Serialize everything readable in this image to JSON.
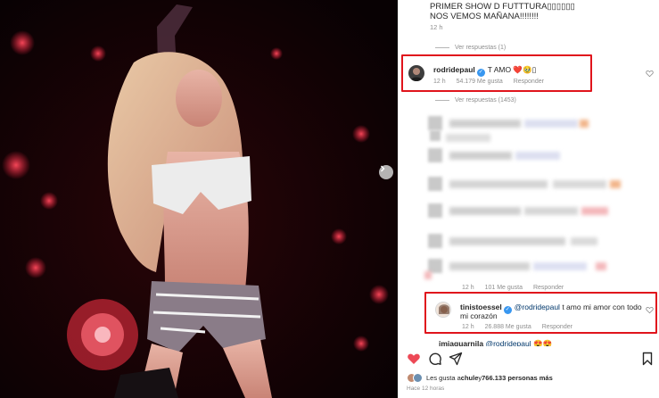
{
  "caption": {
    "lines": [
      "PRIMER SHOW D FUTTTURA▯▯▯▯▯▯",
      "NOS VEMOS MAÑANA!!!!!!!!"
    ],
    "time": "12 h"
  },
  "view_replies_1": "Ver respuestas (1)",
  "comment_rodri": {
    "username": "rodridepaul",
    "text": "T AMO ❤️🥹▯",
    "time": "12 h",
    "likes": "54.179 Me gusta",
    "reply": "Responder"
  },
  "view_replies_1453": "Ver respuestas (1453)",
  "comment_partial": {
    "time": "12 h",
    "likes": "101 Me gusta",
    "reply": "Responder"
  },
  "comment_tini": {
    "username": "tinistoessel",
    "mention": "@rodridepaul",
    "text_line1": "t amo mi amor con todo",
    "text_line2": "mi corazón",
    "time": "12 h",
    "likes": "26.888 Me gusta",
    "reply": "Responder"
  },
  "comment_cut": {
    "username": "imiaguarnila",
    "mention": "@rodridepaul",
    "emojis": "😍😍"
  },
  "likes_summary": {
    "prefix": "Les gusta a ",
    "user": "chule",
    "middle": " y ",
    "count": "766.133 personas más"
  },
  "post_time": "Hace 12 horas",
  "colors": {
    "highlight": "#e0141c",
    "verified": "#3897f0",
    "liked_heart": "#ed4956",
    "mention": "#00376b"
  },
  "icons": [
    "chevron-right-icon",
    "heart-icon",
    "comment-icon",
    "share-icon",
    "bookmark-icon",
    "verified-badge-icon"
  ]
}
